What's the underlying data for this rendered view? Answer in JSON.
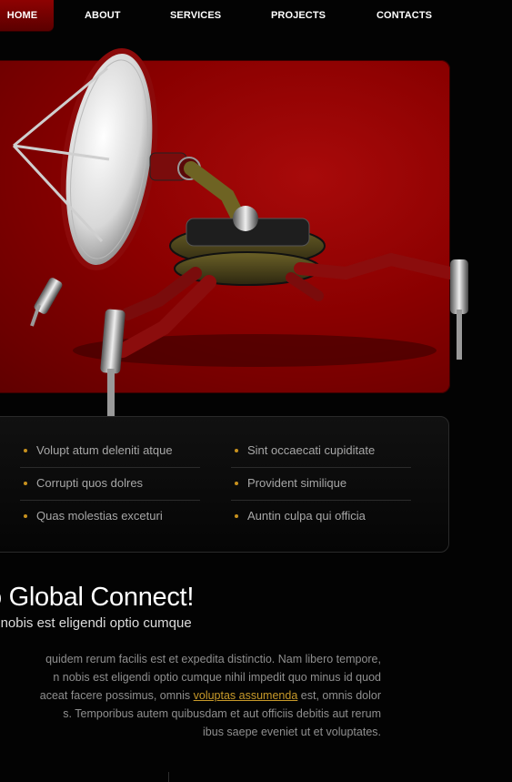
{
  "nav": {
    "items": [
      {
        "label": "HOME",
        "active": true
      },
      {
        "label": "ABOUT",
        "active": false
      },
      {
        "label": "SERVICES",
        "active": false
      },
      {
        "label": "PROJECTS",
        "active": false
      },
      {
        "label": "CONTACTS",
        "active": false
      }
    ]
  },
  "features": {
    "left": [
      "Volupt atum deleniti atque",
      "Corrupti quos dolres",
      "Quas molestias exceturi"
    ],
    "right": [
      "Sint occaecati cupiditate",
      "Provident similique",
      "Auntin culpa qui officia"
    ]
  },
  "welcome": {
    "title": "ome to Global Connect!",
    "subtitle": "ro tempore, cum soluta nobis est eligendi optio cumque",
    "lines": [
      "quidem rerum facilis est et expedita distinctio. Nam libero tempore,",
      "n nobis est eligendi optio cumque nihil impedit quo minus id quod",
      "aceat facere possimus, omnis",
      "est, omnis dolor",
      "s. Temporibus autem quibusdam et aut officiis debitis aut rerum",
      "ibus saepe eveniet ut et voluptates."
    ],
    "link_text": "voluptas assumenda"
  },
  "colors": {
    "accent_red": "#8a0000",
    "bullet_gold": "#c7911e",
    "link_gold": "#c89a2a"
  }
}
